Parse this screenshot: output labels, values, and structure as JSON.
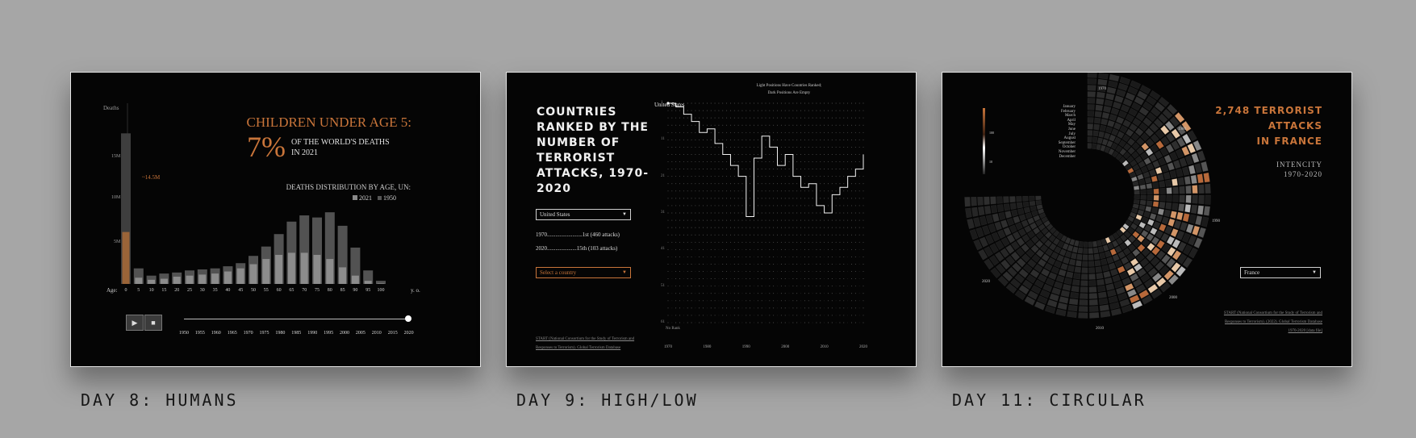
{
  "cards": [
    {
      "caption": "DAY 8: HUMANS",
      "y_axis_title": "Deaths",
      "y_ticks": [
        "15M",
        "10M",
        "5M"
      ],
      "annotation": "~14.5M",
      "headline": "CHILDREN UNDER AGE 5:",
      "big_percent": "7%",
      "percent_text_line1": "OF THE WORLD'S DEATHS",
      "percent_text_line2": "IN 2021",
      "distribution_title": "DEATHS DISTRIBUTION BY AGE, UN:",
      "legend_2021": "2021",
      "legend_1950": "1950",
      "age_label": "Age:",
      "age_unit": "y. o.",
      "ages": [
        "0",
        "5",
        "10",
        "15",
        "20",
        "25",
        "30",
        "35",
        "40",
        "45",
        "50",
        "55",
        "60",
        "65",
        "70",
        "75",
        "80",
        "85",
        "90",
        "95",
        "100"
      ],
      "years": [
        "1950",
        "1955",
        "1960",
        "1965",
        "1970",
        "1975",
        "1980",
        "1985",
        "1990",
        "1995",
        "2000",
        "2005",
        "2010",
        "2015",
        "2020"
      ],
      "play_icon": "play-icon",
      "stop_icon": "stop-icon",
      "chart_data": {
        "type": "bar",
        "categories": [
          "0",
          "5",
          "10",
          "15",
          "20",
          "25",
          "30",
          "35",
          "40",
          "45",
          "50",
          "55",
          "60",
          "65",
          "70",
          "75",
          "80",
          "85",
          "90",
          "95",
          "100"
        ],
        "ylim": [
          0,
          16
        ],
        "series": [
          {
            "name": "2021",
            "values": [
              5.0,
              0.6,
              0.4,
              0.5,
              0.7,
              0.8,
              0.9,
              1.0,
              1.2,
              1.5,
              1.9,
              2.4,
              2.8,
              3.0,
              3.0,
              2.8,
              2.4,
              1.6,
              0.8,
              0.3,
              0.05
            ]
          },
          {
            "name": "1950",
            "values": [
              14.5,
              1.5,
              0.8,
              1.0,
              1.1,
              1.3,
              1.4,
              1.5,
              1.7,
              2.0,
              2.7,
              3.6,
              4.8,
              6.0,
              6.6,
              6.4,
              6.9,
              5.6,
              3.5,
              1.3,
              0.3
            ]
          }
        ]
      }
    },
    {
      "caption": "DAY 9: HIGH/LOW",
      "title_lines": [
        "COUNTRIES",
        "RANKED BY THE",
        "NUMBER OF",
        "TERRORIST",
        "ATTACKS, 1970-",
        "2020"
      ],
      "select_country": "United States",
      "rank_1970": "1970.........................1st (460 attacks)",
      "rank_2020": "2020.....................15th (103 attacks)",
      "select_placeholder": "Select a country",
      "source_line1": "START (National Consortium for the Study of Terrorism and",
      "source_line2": "Responses to Terrorism). Global Terrorism Database",
      "note_line1": "Light Positions Have Countries Ranked;",
      "note_line2": "Dark Positions Are Empty",
      "start_label": "United States",
      "y_ticks": [
        "1",
        "11",
        "21",
        "31",
        "41",
        "51",
        "61"
      ],
      "bottom_label": "No Rank",
      "x_ticks": [
        "1970",
        "1980",
        "1990",
        "2000",
        "2010",
        "2020"
      ],
      "chart_data": {
        "type": "line",
        "series": [
          {
            "name": "United States",
            "x": [
              1970,
              1972,
              1974,
              1976,
              1978,
              1980,
              1982,
              1984,
              1986,
              1988,
              1990,
              1992,
              1994,
              1996,
              1998,
              2000,
              2002,
              2004,
              2006,
              2008,
              2010,
              2012,
              2014,
              2016,
              2018,
              2020
            ],
            "y": [
              1,
              2,
              4,
              6,
              9,
              8,
              12,
              15,
              18,
              21,
              32,
              16,
              10,
              13,
              18,
              15,
              21,
              24,
              23,
              29,
              31,
              26,
              24,
              21,
              19,
              15
            ]
          }
        ]
      }
    },
    {
      "caption": "DAY 11: CIRCULAR",
      "title_line1": "2,748 TERRORIST",
      "title_line2": "ATTACKS",
      "title_line3": "IN FRANCE",
      "subtitle_line1": "INTENCITY",
      "subtitle_line2": "1970-2020",
      "months": [
        "January",
        "February",
        "March",
        "April",
        "May",
        "June",
        "July",
        "August",
        "September",
        "October",
        "November",
        "December"
      ],
      "scale_max": "100",
      "scale_min": "10",
      "year_labels": [
        "1970",
        "1980",
        "1990",
        "2000",
        "2010",
        "2020"
      ],
      "select_country": "France",
      "source_line1": "START (National Consortium for the Study of Terrorism and",
      "source_line2": "Responses to Terrorism). (2022). Global Terrorism Database",
      "source_line3": "1970-2020 [data file]"
    }
  ],
  "colors": {
    "accent": "#c9753a",
    "background": "#a6a6a6",
    "card": "#050505"
  }
}
